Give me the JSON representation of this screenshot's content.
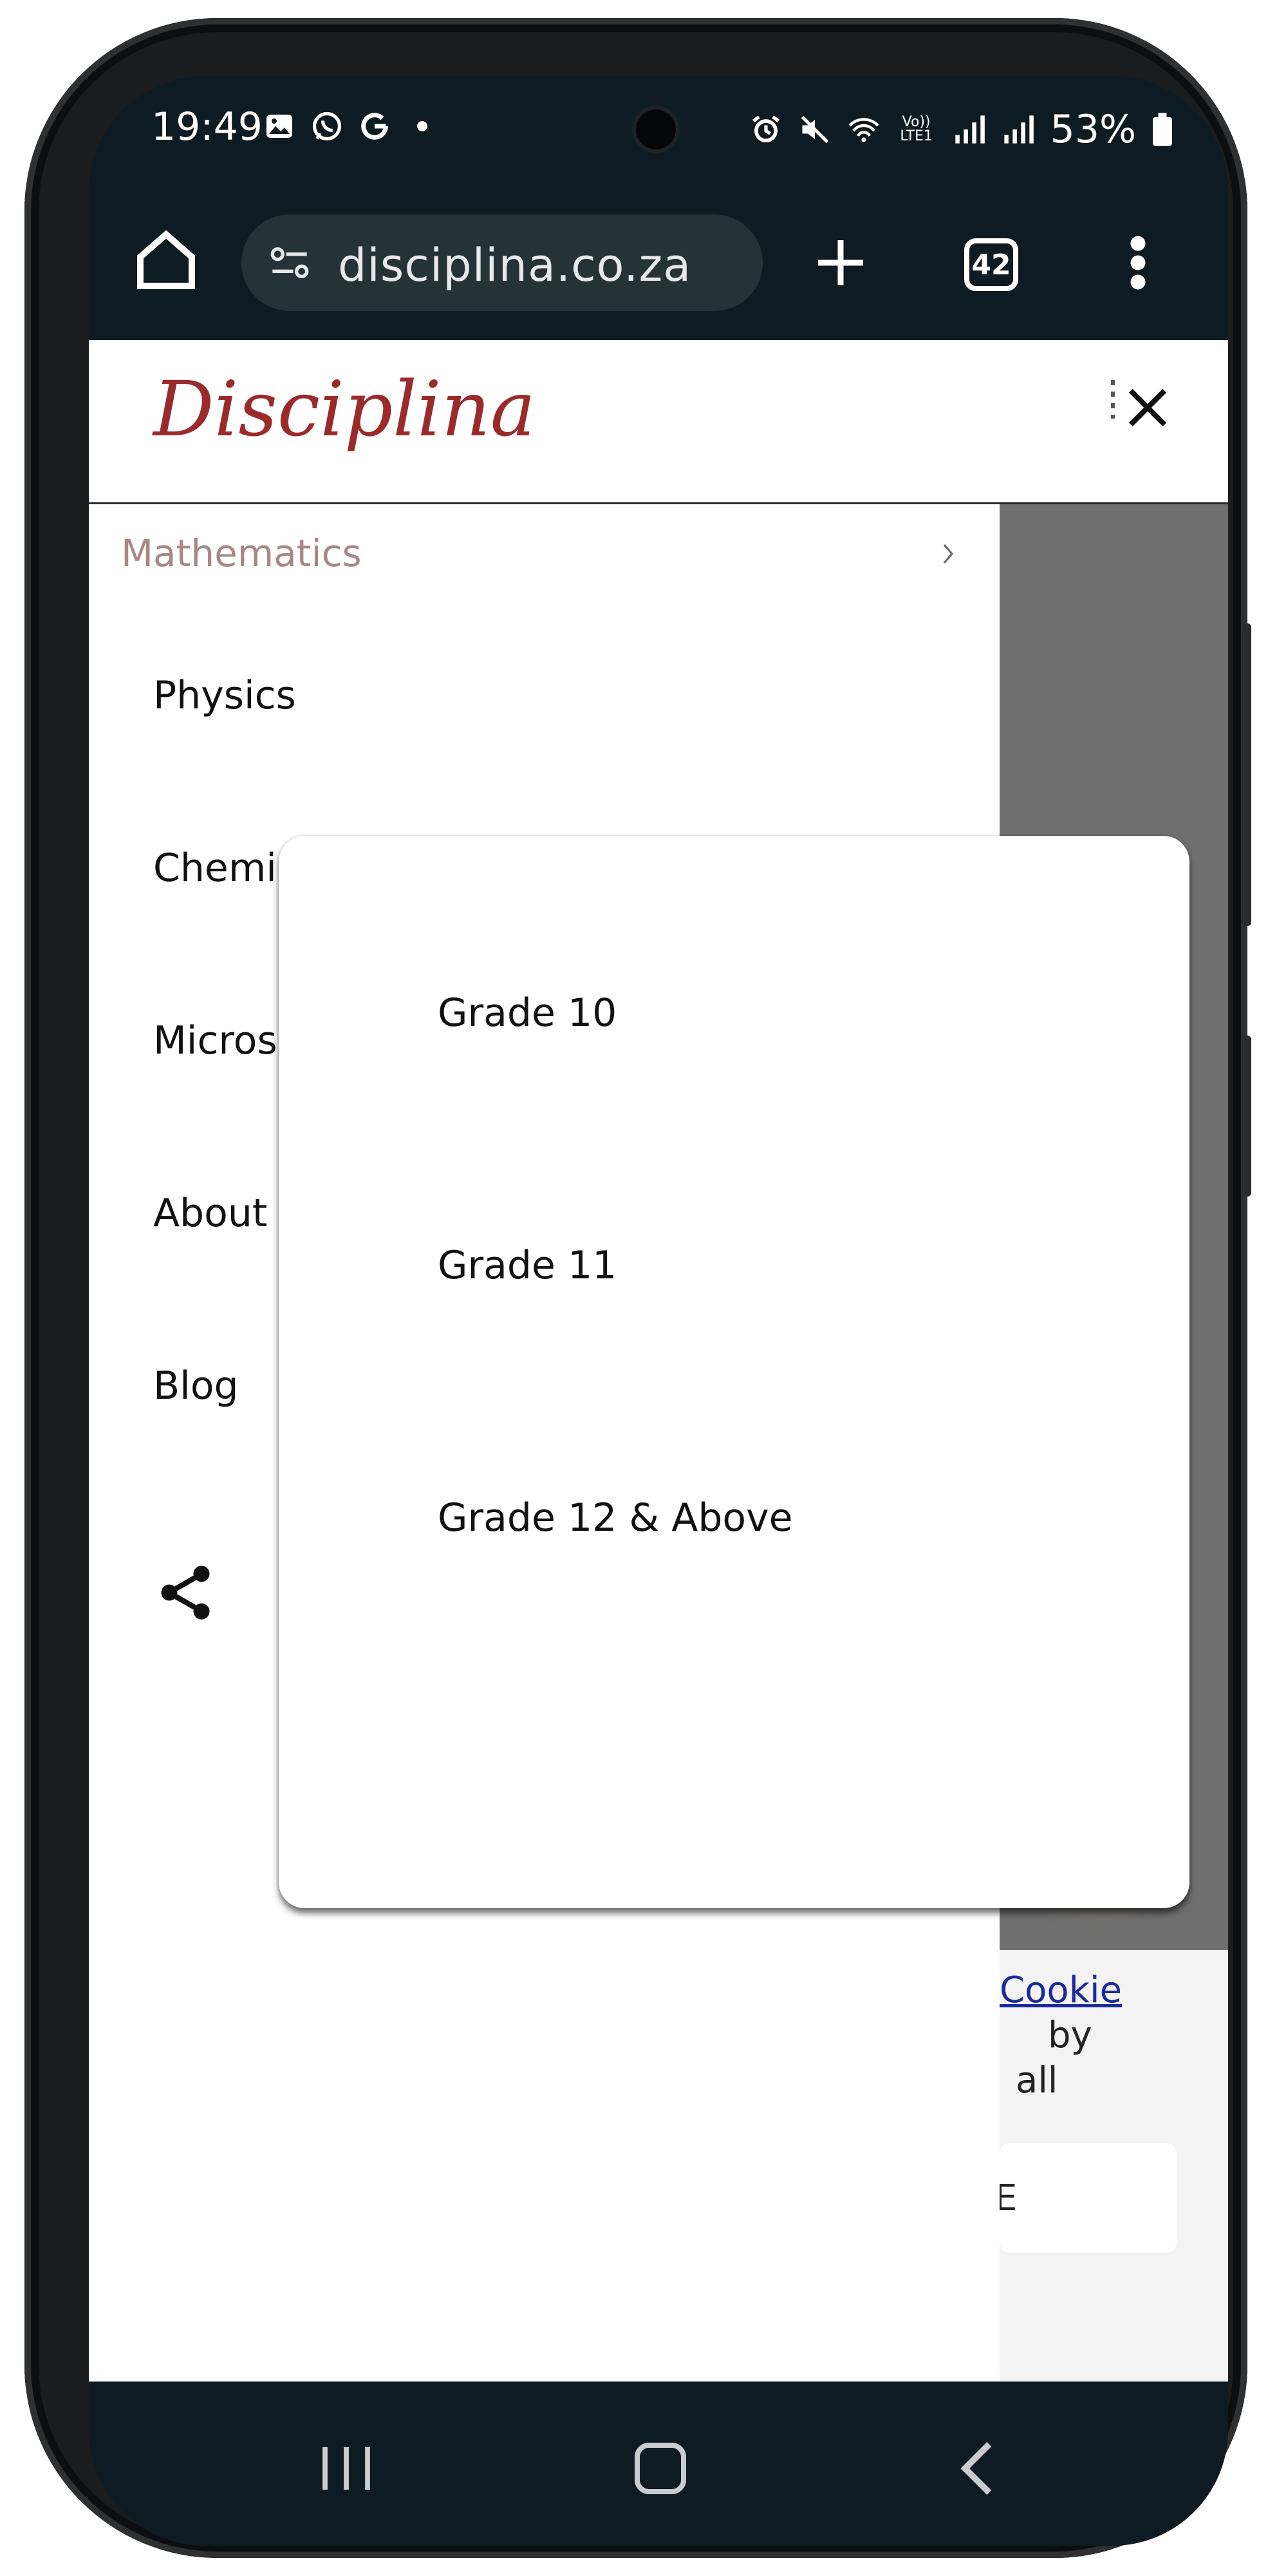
{
  "status_bar": {
    "time": "19:49",
    "battery": "53%",
    "left_icons": [
      "gallery-icon",
      "whatsapp-icon",
      "google-icon",
      "dot-icon"
    ],
    "right_icons": [
      "alarm-icon",
      "mute-icon",
      "wifi-icon",
      "volte-icon",
      "signal-icon",
      "signal-icon",
      "battery-icon"
    ],
    "volte_label": "Vo))\nLTE1"
  },
  "browser": {
    "url": "disciplina.co.za",
    "tab_count": "42"
  },
  "site": {
    "logo": "Disciplina",
    "brand_color": "#9b2b2b"
  },
  "nav": {
    "items": [
      {
        "label": "Mathematics"
      },
      {
        "label": "Physics"
      },
      {
        "label": "Chemistry"
      },
      {
        "label": "Microscopy"
      },
      {
        "label": "About"
      },
      {
        "label": "Blog"
      }
    ]
  },
  "dropdown": {
    "options": [
      "Grade 10",
      "Grade 11",
      "Grade 12 & Above"
    ]
  },
  "cookie": {
    "link_text": "Cookie",
    "line1": "by",
    "line2": "all",
    "button_text": "E"
  }
}
